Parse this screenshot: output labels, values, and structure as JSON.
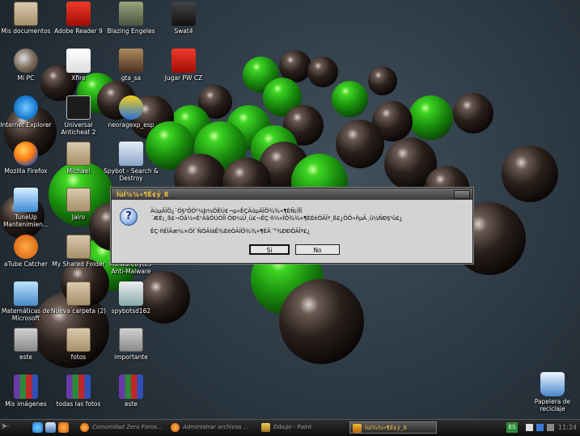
{
  "desktop": {
    "icons": [
      {
        "label": "Mis documentos",
        "icon": "folder-icon"
      },
      {
        "label": "Adobe Reader 9",
        "icon": "pdf-icon"
      },
      {
        "label": "Blazing Engeles",
        "icon": "game-icon"
      },
      {
        "label": "Swat4",
        "icon": "game-icon"
      },
      {
        "label": "Mi PC",
        "icon": "computer-icon"
      },
      {
        "label": "Xfire",
        "icon": "xfire-icon"
      },
      {
        "label": "gta_sa",
        "icon": "game-icon"
      },
      {
        "label": "Jugar PW CZ",
        "icon": "game-icon"
      },
      {
        "label": "Internet Explorer",
        "icon": "ie-icon"
      },
      {
        "label": "Universal Anticheat 2",
        "icon": "uac-icon"
      },
      {
        "label": "neoragexp_esp",
        "icon": "neo-icon"
      },
      {
        "label": "Mozilla Firefox",
        "icon": "firefox-icon"
      },
      {
        "label": "Michael",
        "icon": "folder-icon"
      },
      {
        "label": "Spybot - Search & Destroy",
        "icon": "spybot-icon"
      },
      {
        "label": "TuneUp Mantenimien...",
        "icon": "tuneup-icon"
      },
      {
        "label": "Jairo",
        "icon": "folder-icon"
      },
      {
        "label": "aTube Catcher",
        "icon": "atube-icon"
      },
      {
        "label": "My Shared Folder",
        "icon": "folder-icon"
      },
      {
        "label": "Malwarebytes' Anti-Malware",
        "icon": "malwarebytes-icon"
      },
      {
        "label": "Matemáticas de Microsoft",
        "icon": "calculator-icon"
      },
      {
        "label": "Nueva carpeta (2)",
        "icon": "folder-icon"
      },
      {
        "label": "spybotsd162",
        "icon": "installer-icon"
      },
      {
        "label": "este",
        "icon": "file-icon"
      },
      {
        "label": "fotos",
        "icon": "folder-icon"
      },
      {
        "label": "importante",
        "icon": "file-icon"
      },
      {
        "label": "Mis imágenes",
        "icon": "winrar-icon"
      },
      {
        "label": "todas las fotos",
        "icon": "winrar-icon"
      },
      {
        "label": "este",
        "icon": "winrar-icon"
      },
      {
        "label": "Papelera de reciclaje",
        "icon": "recycle-bin-icon"
      }
    ]
  },
  "dialog": {
    "title": "ÌùÍ¾¾«¶É¢ý¸8",
    "message": "ÄúµÄÏÔ¿¨Ö§³ÖÓ²¼þ¼ÓËÙ£¬µ«ÊÇÄúµÄÏÔ¾¾«¶ÈÑ¡ÏîÎ´ÆÉ¡¸ß£¬Õâ½«Ê¹ÄãÔÚÓÎÏ·ÖÐ¼Ü¸ü£¬ÊÇ·ñ½«ÏÔ¾¾«¶ÈÉèÖÃÎª¸ß£¿ÒÔ»ñµÃ¸ü¼ÑÐ§¹û£¿",
    "submessage": "ÊÇ·ñÉÏÃæ¼×ÖÍ¨ÑÓÃÌáÊ¾ÉèÖÃÏÔ¾¾«¶ÈÃ´°¾ÐÐÖÃÎª£¿",
    "yes_label": "Sí",
    "no_label": "No"
  },
  "taskbar": {
    "tasks": [
      {
        "label": "Comunidad Zero Foros...",
        "active": false
      },
      {
        "label": "Administrar archivos ...",
        "active": false
      },
      {
        "label": "Dibujo - Paint",
        "active": false
      },
      {
        "label": "ÌùÍ¾¾«¶É¢ý¸8",
        "active": true
      }
    ],
    "language": "ES",
    "clock": "11:24"
  }
}
